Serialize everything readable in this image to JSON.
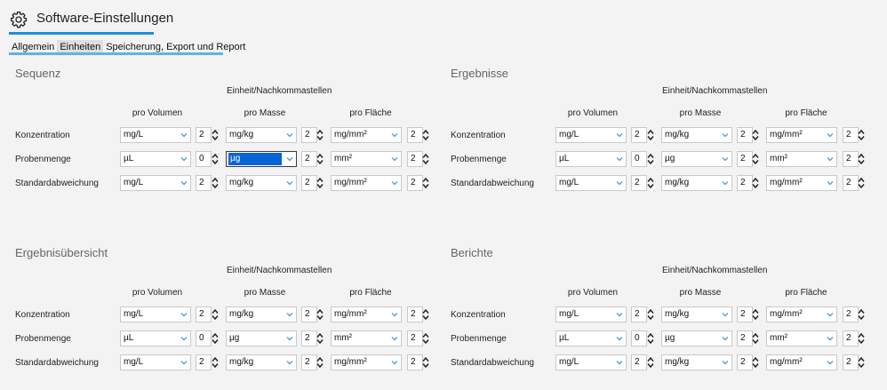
{
  "app": {
    "title": "Software-Einstellungen",
    "icon": "gear-icon"
  },
  "tabs": [
    {
      "label": "Allgemein",
      "active": false
    },
    {
      "label": "Einheiten",
      "active": true
    },
    {
      "label": "Speicherung, Export und Report",
      "active": false
    }
  ],
  "colors": {
    "accent": "#1e8fd6",
    "selection": "#0a64d6"
  },
  "sections": [
    {
      "title": "Sequenz",
      "group_label": "Einheit/Nachkommastellen",
      "columns": [
        "pro Volumen",
        "pro Masse",
        "pro Fläche"
      ],
      "rows": [
        {
          "label": "Konzentration",
          "units": [
            "mg/L",
            "mg/kg",
            "mg/mm²"
          ],
          "decimals": [
            "2",
            "2",
            "2"
          ]
        },
        {
          "label": "Probenmenge",
          "units": [
            "µL",
            "µg",
            "mm²"
          ],
          "decimals": [
            "0",
            "2",
            "2"
          ]
        },
        {
          "label": "Standardabweichung",
          "units": [
            "mg/L",
            "mg/kg",
            "mg/mm²"
          ],
          "decimals": [
            "2",
            "2",
            "2"
          ]
        }
      ]
    },
    {
      "title": "Ergebnisse",
      "group_label": "Einheit/Nachkommastellen",
      "columns": [
        "pro Volumen",
        "pro Masse",
        "pro Fläche"
      ],
      "rows": [
        {
          "label": "Konzentration",
          "units": [
            "mg/L",
            "mg/kg",
            "mg/mm²"
          ],
          "decimals": [
            "2",
            "2",
            "2"
          ]
        },
        {
          "label": "Probenmenge",
          "units": [
            "µL",
            "µg",
            "mm²"
          ],
          "decimals": [
            "0",
            "2",
            "2"
          ]
        },
        {
          "label": "Standardabweichung",
          "units": [
            "mg/L",
            "mg/kg",
            "mg/mm²"
          ],
          "decimals": [
            "2",
            "2",
            "2"
          ]
        }
      ]
    },
    {
      "title": "Ergebnisübersicht",
      "group_label": "Einheit/Nachkommastellen",
      "columns": [
        "pro Volumen",
        "pro Masse",
        "pro Fläche"
      ],
      "rows": [
        {
          "label": "Konzentration",
          "units": [
            "mg/L",
            "mg/kg",
            "mg/mm²"
          ],
          "decimals": [
            "2",
            "2",
            "2"
          ]
        },
        {
          "label": "Probenmenge",
          "units": [
            "µL",
            "µg",
            "mm²"
          ],
          "decimals": [
            "0",
            "2",
            "2"
          ]
        },
        {
          "label": "Standardabweichung",
          "units": [
            "mg/L",
            "mg/kg",
            "mg/mm²"
          ],
          "decimals": [
            "2",
            "2",
            "2"
          ]
        }
      ]
    },
    {
      "title": "Berichte",
      "group_label": "Einheit/Nachkommastellen",
      "columns": [
        "pro Volumen",
        "pro Masse",
        "pro Fläche"
      ],
      "rows": [
        {
          "label": "Konzentration",
          "units": [
            "mg/L",
            "mg/kg",
            "mg/mm²"
          ],
          "decimals": [
            "2",
            "2",
            "2"
          ]
        },
        {
          "label": "Probenmenge",
          "units": [
            "µL",
            "µg",
            "mm²"
          ],
          "decimals": [
            "0",
            "2",
            "2"
          ]
        },
        {
          "label": "Standardabweichung",
          "units": [
            "mg/L",
            "mg/kg",
            "mg/mm²"
          ],
          "decimals": [
            "2",
            "2",
            "2"
          ]
        }
      ]
    }
  ]
}
